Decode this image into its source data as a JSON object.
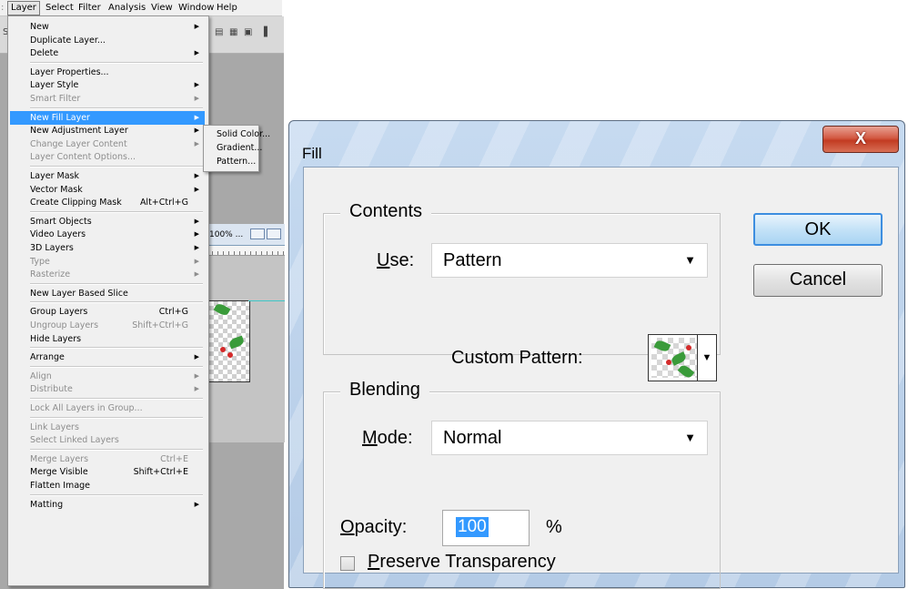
{
  "menubar": [
    "Layer",
    "Select",
    "Filter",
    "Analysis",
    "View",
    "Window",
    "Help"
  ],
  "layer_menu": [
    {
      "label": "New",
      "arrow": true
    },
    {
      "label": "Duplicate Layer..."
    },
    {
      "label": "Delete",
      "arrow": true
    },
    {
      "sep": true
    },
    {
      "label": "Layer Properties..."
    },
    {
      "label": "Layer Style",
      "arrow": true
    },
    {
      "label": "Smart Filter",
      "arrow": true,
      "disabled": true
    },
    {
      "sep": true
    },
    {
      "label": "New Fill Layer",
      "arrow": true,
      "highlight": true
    },
    {
      "label": "New Adjustment Layer",
      "arrow": true
    },
    {
      "label": "Change Layer Content",
      "arrow": true,
      "disabled": true
    },
    {
      "label": "Layer Content Options...",
      "disabled": true
    },
    {
      "sep": true
    },
    {
      "label": "Layer Mask",
      "arrow": true
    },
    {
      "label": "Vector Mask",
      "arrow": true
    },
    {
      "label": "Create Clipping Mask",
      "shortcut": "Alt+Ctrl+G"
    },
    {
      "sep": true
    },
    {
      "label": "Smart Objects",
      "arrow": true
    },
    {
      "label": "Video Layers",
      "arrow": true
    },
    {
      "label": "3D Layers",
      "arrow": true
    },
    {
      "label": "Type",
      "arrow": true,
      "disabled": true
    },
    {
      "label": "Rasterize",
      "arrow": true,
      "disabled": true
    },
    {
      "sep": true
    },
    {
      "label": "New Layer Based Slice"
    },
    {
      "sep": true
    },
    {
      "label": "Group Layers",
      "shortcut": "Ctrl+G"
    },
    {
      "label": "Ungroup Layers",
      "shortcut": "Shift+Ctrl+G",
      "disabled": true
    },
    {
      "label": "Hide Layers"
    },
    {
      "sep": true
    },
    {
      "label": "Arrange",
      "arrow": true
    },
    {
      "sep": true
    },
    {
      "label": "Align",
      "arrow": true,
      "disabled": true
    },
    {
      "label": "Distribute",
      "arrow": true,
      "disabled": true
    },
    {
      "sep": true
    },
    {
      "label": "Lock All Layers in Group...",
      "disabled": true
    },
    {
      "sep": true
    },
    {
      "label": "Link Layers",
      "disabled": true
    },
    {
      "label": "Select Linked Layers",
      "disabled": true
    },
    {
      "sep": true
    },
    {
      "label": "Merge Layers",
      "shortcut": "Ctrl+E",
      "disabled": true
    },
    {
      "label": "Merge Visible",
      "shortcut": "Shift+Ctrl+E"
    },
    {
      "label": "Flatten Image"
    },
    {
      "sep": true
    },
    {
      "label": "Matting",
      "arrow": true
    }
  ],
  "fill_submenu": [
    "Solid Color...",
    "Gradient...",
    "Pattern..."
  ],
  "doc_window": {
    "zoom": "100% ..."
  },
  "dialog": {
    "title": "Fill",
    "close_glyph": "X",
    "contents": {
      "legend": "Contents",
      "use_label": "Use:",
      "use_value": "Pattern",
      "custom_pattern_label": "Custom Pattern:"
    },
    "blending": {
      "legend": "Blending",
      "mode_label": "Mode:",
      "mode_value": "Normal",
      "opacity_label": "Opacity:",
      "opacity_value": "100",
      "opacity_unit": "%",
      "preserve_label": "Preserve Transparency",
      "preserve_checked": false
    },
    "ok_label": "OK",
    "cancel_label": "Cancel"
  }
}
